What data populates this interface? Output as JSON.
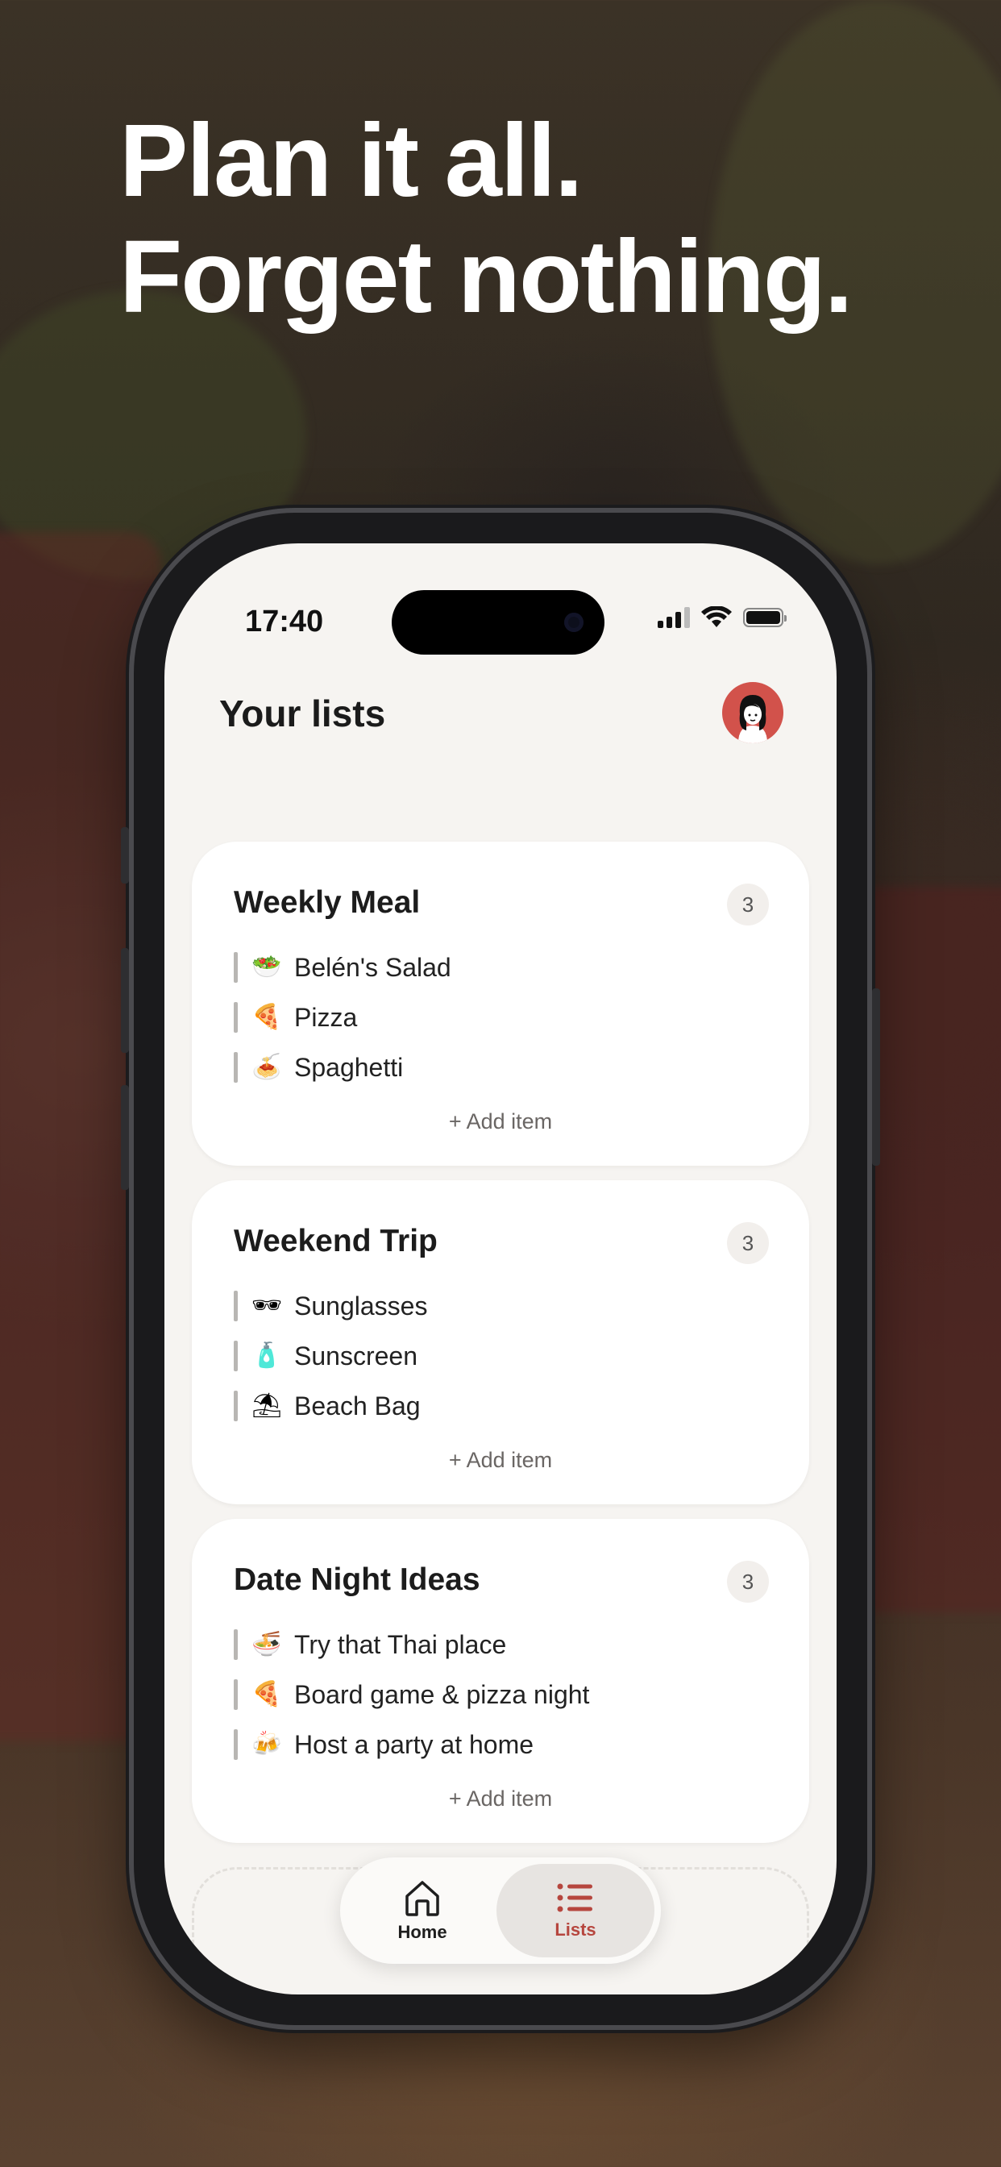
{
  "headline": {
    "line1": "Plan it all.",
    "line2": "Forget nothing."
  },
  "status_bar": {
    "time": "17:40"
  },
  "header": {
    "title": "Your lists",
    "avatar_icon": "user-avatar"
  },
  "lists": [
    {
      "title": "Weekly Meal",
      "count": "3",
      "items": [
        {
          "icon": "salad-emoji",
          "emoji": "🥗",
          "label": "Belén's Salad"
        },
        {
          "icon": "pizza-emoji",
          "emoji": "🍕",
          "label": "Pizza"
        },
        {
          "icon": "spaghetti-emoji",
          "emoji": "🍝",
          "label": "Spaghetti"
        }
      ],
      "add_label": "+ Add item"
    },
    {
      "title": "Weekend Trip",
      "count": "3",
      "items": [
        {
          "icon": "sunglasses-emoji",
          "emoji": "🕶",
          "label": "Sunglasses"
        },
        {
          "icon": "lotion-bottle-emoji",
          "emoji": "🧴",
          "label": "Sunscreen"
        },
        {
          "icon": "beach-umbrella-emoji",
          "emoji": "⛱",
          "label": "Beach Bag"
        }
      ],
      "add_label": "+ Add item"
    },
    {
      "title": "Date Night Ideas",
      "count": "3",
      "items": [
        {
          "icon": "noodle-bowl-emoji",
          "emoji": "🍜",
          "label": "Try that Thai place"
        },
        {
          "icon": "pizza-emoji",
          "emoji": "🍕",
          "label": "Board game & pizza night"
        },
        {
          "icon": "cheers-emoji",
          "emoji": "🍻",
          "label": "Host a party at home"
        }
      ],
      "add_label": "+ Add item"
    }
  ],
  "tabbar": {
    "tabs": [
      {
        "label": "Home",
        "icon": "home-icon",
        "active": false
      },
      {
        "label": "Lists",
        "icon": "list-icon",
        "active": true
      }
    ]
  },
  "colors": {
    "accent": "#b6463e",
    "avatar_bg": "#d2524b",
    "screen_bg": "#f6f4f1"
  }
}
